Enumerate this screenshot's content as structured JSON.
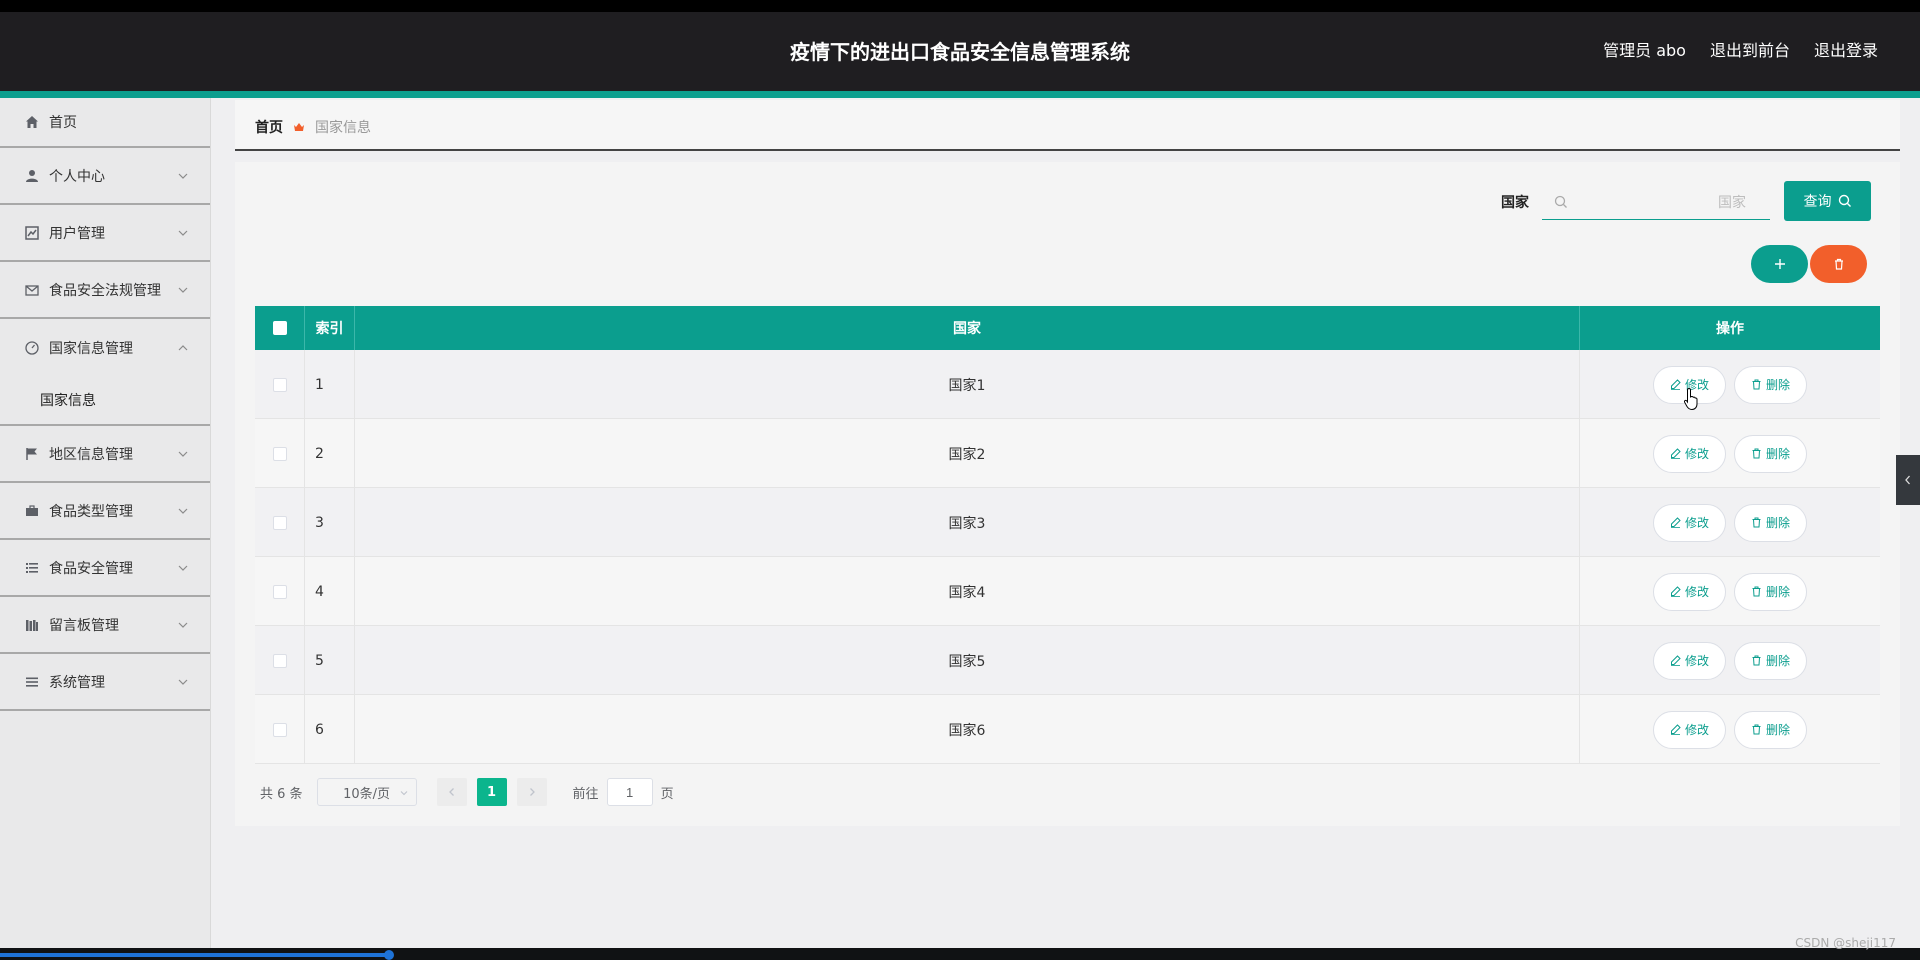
{
  "header": {
    "title": "疫情下的进出口食品安全信息管理系统",
    "admin": "管理员 abo",
    "to_front": "退出到前台",
    "logout": "退出登录"
  },
  "sidebar": {
    "items": [
      {
        "label": "首页",
        "icon": "home-icon"
      },
      {
        "label": "个人中心",
        "icon": "user-icon"
      },
      {
        "label": "用户管理",
        "icon": "chart-icon"
      },
      {
        "label": "食品安全法规管理",
        "icon": "mail-icon"
      },
      {
        "label": "国家信息管理",
        "icon": "gauge-icon"
      },
      {
        "label": "国家信息",
        "icon": ""
      },
      {
        "label": "地区信息管理",
        "icon": "flag-icon"
      },
      {
        "label": "食品类型管理",
        "icon": "briefcase-icon"
      },
      {
        "label": "食品安全管理",
        "icon": "list-icon"
      },
      {
        "label": "留言板管理",
        "icon": "books-icon"
      },
      {
        "label": "系统管理",
        "icon": "menu-icon"
      }
    ]
  },
  "breadcrumb": {
    "home": "首页",
    "current": "国家信息"
  },
  "search": {
    "label": "国家",
    "placeholder": "国家",
    "button": "查询"
  },
  "table": {
    "headers": {
      "index": "索引",
      "country": "国家",
      "ops": "操作"
    },
    "edit_label": "修改",
    "delete_label": "删除",
    "rows": [
      {
        "index": "1",
        "country": "国家1"
      },
      {
        "index": "2",
        "country": "国家2"
      },
      {
        "index": "3",
        "country": "国家3"
      },
      {
        "index": "4",
        "country": "国家4"
      },
      {
        "index": "5",
        "country": "国家5"
      },
      {
        "index": "6",
        "country": "国家6"
      }
    ]
  },
  "pager": {
    "total": "共 6 条",
    "page_size": "10条/页",
    "current_page": "1",
    "goto_prefix": "前往",
    "goto_value": "1",
    "goto_suffix": "页"
  },
  "watermark": "CSDN @sheji117",
  "colors": {
    "primary": "#0b9e8e",
    "danger": "#f25f2b",
    "header_bg": "#1f1e21"
  }
}
